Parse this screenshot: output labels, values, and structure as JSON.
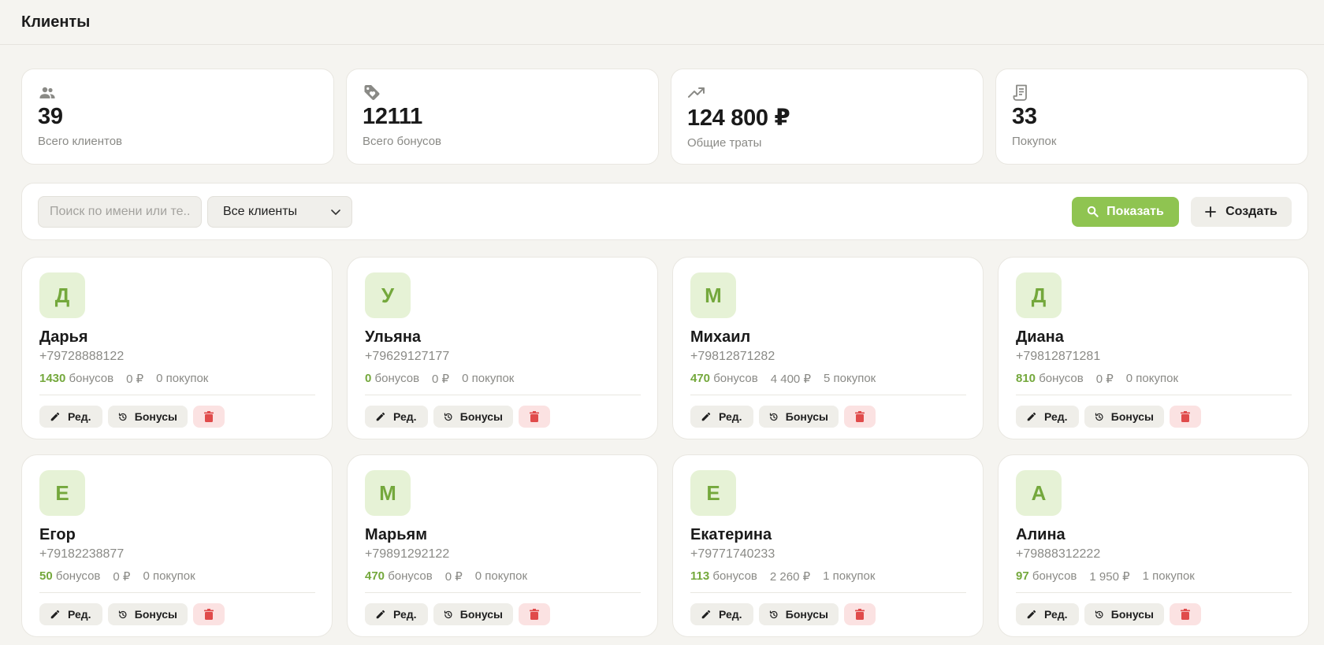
{
  "header": {
    "title": "Клиенты"
  },
  "stats": [
    {
      "icon": "users-icon",
      "value": "39",
      "label": "Всего клиентов"
    },
    {
      "icon": "tag-icon",
      "value": "12111",
      "label": "Всего бонусов"
    },
    {
      "icon": "trending-up-icon",
      "value": "124 800 ₽",
      "label": "Общие траты"
    },
    {
      "icon": "receipt-icon",
      "value": "33",
      "label": "Покупок"
    }
  ],
  "toolbar": {
    "search_placeholder": "Поиск по имени или те...",
    "filter_value": "Все клиенты",
    "show_label": "Показать",
    "create_label": "Создать"
  },
  "labels": {
    "bonuses": "бонусов",
    "edit": "Ред.",
    "bonus_btn": "Бонусы"
  },
  "clients": [
    {
      "initial": "Д",
      "name": "Дарья",
      "phone": "+79728888122",
      "bonus": "1430",
      "spent": "0 ₽",
      "purchases": "0 покупок"
    },
    {
      "initial": "У",
      "name": "Ульяна",
      "phone": "+79629127177",
      "bonus": "0",
      "spent": "0 ₽",
      "purchases": "0 покупок"
    },
    {
      "initial": "М",
      "name": "Михаил",
      "phone": "+79812871282",
      "bonus": "470",
      "spent": "4 400 ₽",
      "purchases": "5 покупок"
    },
    {
      "initial": "Д",
      "name": "Диана",
      "phone": "+79812871281",
      "bonus": "810",
      "spent": "0 ₽",
      "purchases": "0 покупок"
    },
    {
      "initial": "Е",
      "name": "Егор",
      "phone": "+79182238877",
      "bonus": "50",
      "spent": "0 ₽",
      "purchases": "0 покупок"
    },
    {
      "initial": "М",
      "name": "Марьям",
      "phone": "+79891292122",
      "bonus": "470",
      "spent": "0 ₽",
      "purchases": "0 покупок"
    },
    {
      "initial": "Е",
      "name": "Екатерина",
      "phone": "+79771740233",
      "bonus": "113",
      "spent": "2 260 ₽",
      "purchases": "1 покупок"
    },
    {
      "initial": "А",
      "name": "Алина",
      "phone": "+79888312222",
      "bonus": "97",
      "spent": "1 950 ₽",
      "purchases": "1 покупок"
    }
  ],
  "colors": {
    "accent": "#8fc451",
    "bonus_text": "#74a83c",
    "avatar_bg": "#e6f2d6",
    "danger": "#e04b4b",
    "danger_bg": "#fbe2e2"
  }
}
